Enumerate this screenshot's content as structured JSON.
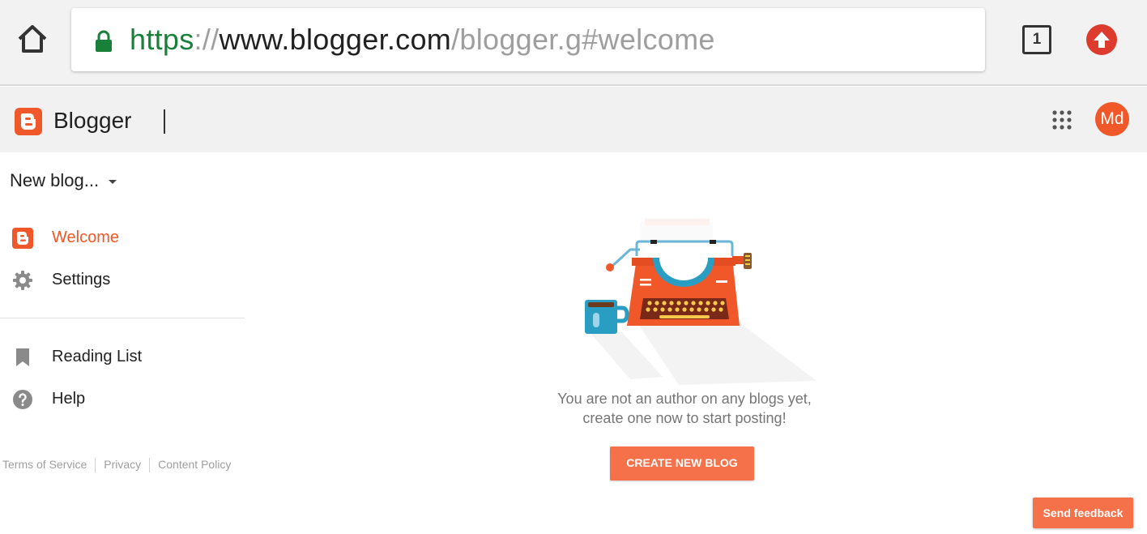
{
  "browser": {
    "url": {
      "scheme": "https",
      "sep": "://",
      "host": "www.blogger.com",
      "path": "/blogger.g#welcome"
    },
    "tab_count": "1"
  },
  "header": {
    "brand": "Blogger",
    "avatar_initials": "Md",
    "accent_color": "#f0582a"
  },
  "sidebar": {
    "blog_selector": "New blog...",
    "items": [
      {
        "label": "Welcome",
        "icon": "blogger-icon",
        "active": true
      },
      {
        "label": "Settings",
        "icon": "gear-icon"
      },
      {
        "label": "Reading List",
        "icon": "bookmark-icon"
      },
      {
        "label": "Help",
        "icon": "help-icon"
      }
    ],
    "footer": [
      "Terms of Service",
      "Privacy",
      "Content Policy"
    ]
  },
  "main": {
    "empty_line1": "You are not an author on any blogs yet,",
    "empty_line2": "create one now to start posting!",
    "create_button": "CREATE NEW BLOG",
    "illustration": "typewriter-illustration"
  },
  "feedback": {
    "label": "Send feedback"
  }
}
